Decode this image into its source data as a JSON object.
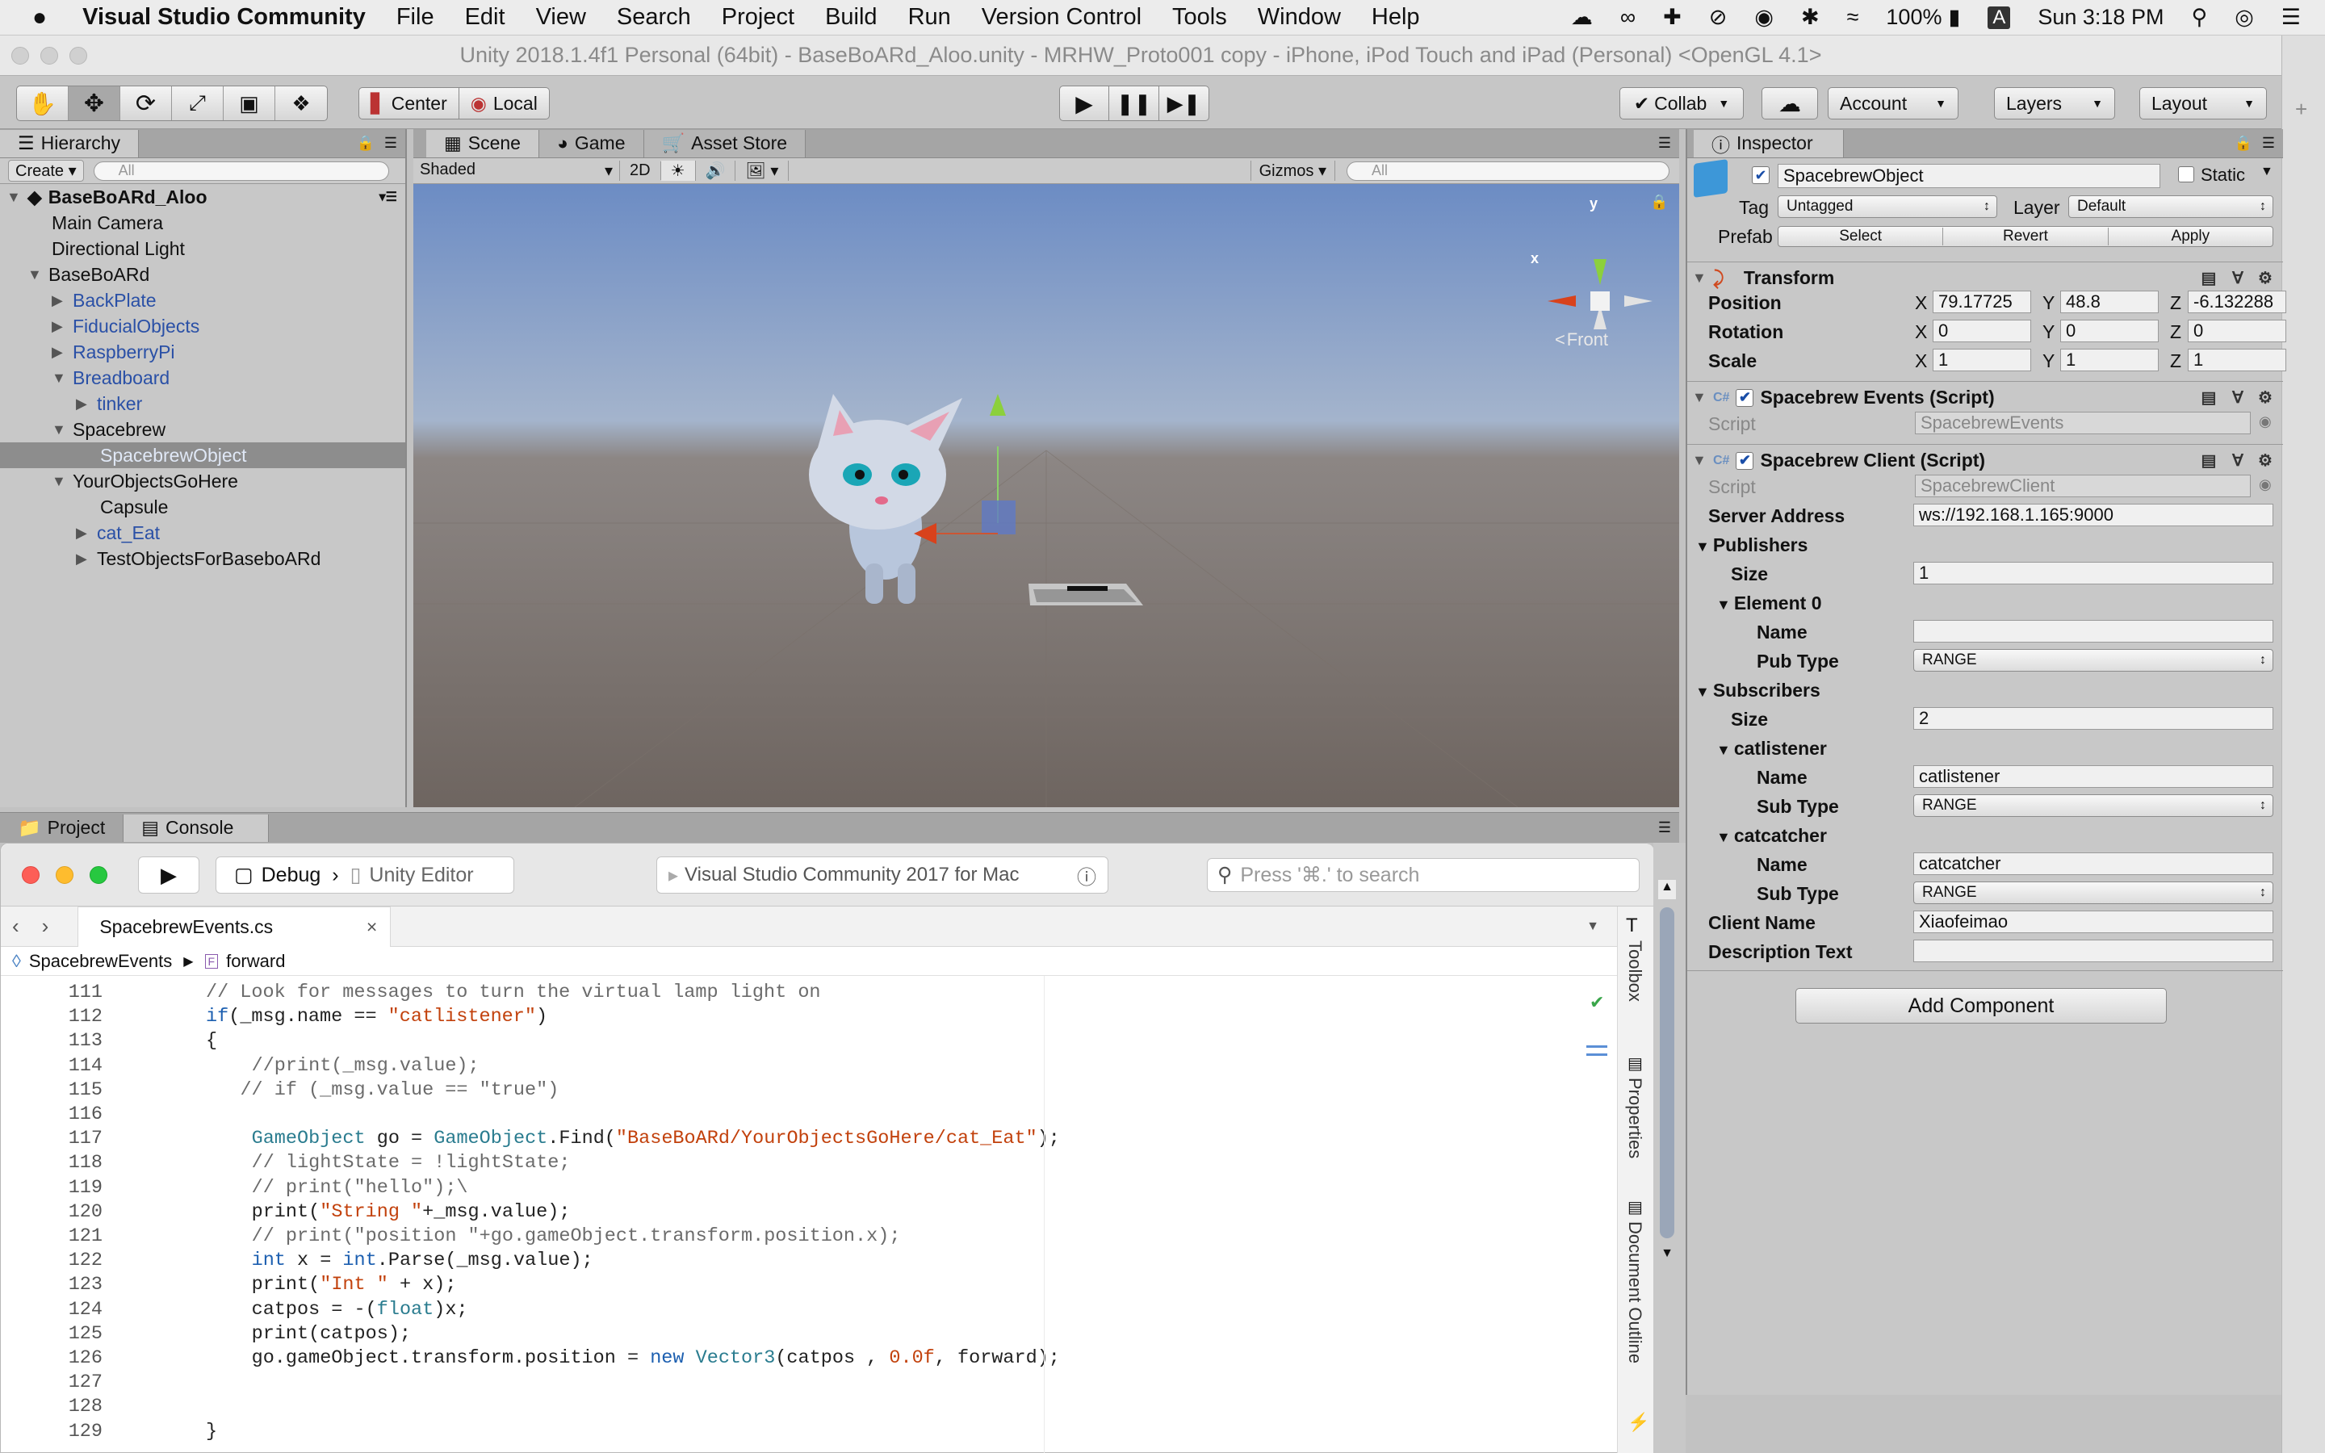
{
  "menubar": {
    "apple": "",
    "app": "Visual Studio Community",
    "items": [
      "File",
      "Edit",
      "View",
      "Search",
      "Project",
      "Build",
      "Run",
      "Version Control",
      "Tools",
      "Window",
      "Help"
    ],
    "battery": "100%",
    "time": "Sun 3:18 PM"
  },
  "unity": {
    "title": "Unity 2018.1.4f1 Personal (64bit) - BaseBoARd_Aloo.unity - MRHW_Proto001 copy - iPhone, iPod Touch and iPad (Personal) <OpenGL 4.1>",
    "toolbar": {
      "center": "Center",
      "local": "Local",
      "collab": "Collab",
      "account": "Account",
      "layers": "Layers",
      "layout": "Layout"
    },
    "hierarchy": {
      "tab": "Hierarchy",
      "create": "Create",
      "search": "All",
      "scene": "BaseBoARd_Aloo",
      "items": [
        {
          "label": "Main Camera",
          "indent": 0,
          "arrow": "",
          "color": "black"
        },
        {
          "label": "Directional Light",
          "indent": 0,
          "arrow": "",
          "color": "black"
        },
        {
          "label": "BaseBoARd",
          "indent": 0,
          "arrow": "down",
          "color": "black"
        },
        {
          "label": "BackPlate",
          "indent": 1,
          "arrow": "right",
          "color": "blue"
        },
        {
          "label": "FiducialObjects",
          "indent": 1,
          "arrow": "right",
          "color": "blue"
        },
        {
          "label": "RaspberryPi",
          "indent": 1,
          "arrow": "right",
          "color": "blue"
        },
        {
          "label": "Breadboard",
          "indent": 1,
          "arrow": "down",
          "color": "blue"
        },
        {
          "label": "tinker",
          "indent": 2,
          "arrow": "right",
          "color": "blue"
        },
        {
          "label": "Spacebrew",
          "indent": 1,
          "arrow": "down",
          "color": "black"
        },
        {
          "label": "SpacebrewObject",
          "indent": 2,
          "arrow": "",
          "color": "selected"
        },
        {
          "label": "YourObjectsGoHere",
          "indent": 1,
          "arrow": "down",
          "color": "black"
        },
        {
          "label": "Capsule",
          "indent": 2,
          "arrow": "",
          "color": "black"
        },
        {
          "label": "cat_Eat",
          "indent": 2,
          "arrow": "right",
          "color": "blue"
        },
        {
          "label": "TestObjectsForBaseboARd",
          "indent": 2,
          "arrow": "right",
          "color": "black"
        }
      ]
    },
    "scene": {
      "tabs": [
        "Scene",
        "Game",
        "Asset Store"
      ],
      "shading": "Shaded",
      "mode2d": "2D",
      "gizmos": "Gizmos",
      "search": "All",
      "axis_y": "y",
      "axis_x": "x",
      "view": "Front"
    },
    "inspector": {
      "tab": "Inspector",
      "object": "SpacebrewObject",
      "static": "Static",
      "tag_label": "Tag",
      "tag": "Untagged",
      "layer_label": "Layer",
      "layer": "Default",
      "prefab": "Prefab",
      "select": "Select",
      "revert": "Revert",
      "apply": "Apply",
      "transform": {
        "title": "Transform",
        "position": "Position",
        "rotation": "Rotation",
        "scale": "Scale",
        "pos": [
          "79.17725",
          "48.8",
          "-6.132288"
        ],
        "rot": [
          "0",
          "0",
          "0"
        ],
        "scl": [
          "1",
          "1",
          "1"
        ]
      },
      "events": {
        "title": "Spacebrew Events (Script)",
        "script_label": "Script",
        "script": "SpacebrewEvents"
      },
      "client": {
        "title": "Spacebrew Client (Script)",
        "script_label": "Script",
        "script": "SpacebrewClient",
        "server_label": "Server Address",
        "server": "ws://192.168.1.165:9000",
        "publishers": "Publishers",
        "size_label": "Size",
        "pub_size": "1",
        "element0": "Element 0",
        "name_label": "Name",
        "pub_name": "",
        "pubtype_label": "Pub Type",
        "pub_type": "RANGE",
        "subscribers": "Subscribers",
        "sub_size": "2",
        "sub1": "catlistener",
        "sub1_name": "catlistener",
        "subtype_label": "Sub Type",
        "sub1_type": "RANGE",
        "sub2": "catcatcher",
        "sub2_name": "catcatcher",
        "sub2_type": "RANGE",
        "client_label": "Client Name",
        "client": "Xiaofeimao",
        "desc_label": "Description Text",
        "desc": ""
      },
      "add_component": "Add Component"
    },
    "bottom_tabs": [
      "Project",
      "Console"
    ]
  },
  "vs": {
    "config": "Debug",
    "target": "Unity Editor",
    "status": "Visual Studio Community 2017 for Mac",
    "search_placeholder": "Press '⌘.' to search",
    "tab": "SpacebrewEvents.cs",
    "crumb1": "SpacebrewEvents",
    "crumb2": "forward",
    "side": [
      "Toolbox",
      "Properties",
      "Document Outline"
    ],
    "lines": [
      {
        "n": "111",
        "ind": 0,
        "t": [
          [
            "cm",
            "// Look for messages to turn the virtual lamp light on"
          ]
        ]
      },
      {
        "n": "112",
        "ind": 0,
        "t": [
          [
            "kw",
            "if"
          ],
          [
            "",
            "(_msg.name == "
          ],
          [
            "st",
            "\"catlistener\""
          ],
          [
            "",
            ")"
          ]
        ]
      },
      {
        "n": "113",
        "ind": 0,
        "t": [
          [
            "",
            "{"
          ]
        ]
      },
      {
        "n": "114",
        "ind": 4,
        "t": [
          [
            "cm",
            "//print(_msg.value);"
          ]
        ]
      },
      {
        "n": "115",
        "ind": 3,
        "t": [
          [
            "cm",
            "// if (_msg.value == \"true\")"
          ]
        ]
      },
      {
        "n": "116",
        "ind": 0,
        "t": []
      },
      {
        "n": "117",
        "ind": 4,
        "t": [
          [
            "ty",
            "GameObject"
          ],
          [
            "",
            " go = "
          ],
          [
            "ty",
            "GameObject"
          ],
          [
            "",
            ".Find("
          ],
          [
            "st",
            "\"BaseBoARd/YourObjectsGoHere/cat_Eat\""
          ],
          [
            "",
            ");"
          ]
        ]
      },
      {
        "n": "118",
        "ind": 4,
        "t": [
          [
            "cm",
            "// lightState = !lightState;"
          ]
        ]
      },
      {
        "n": "119",
        "ind": 4,
        "t": [
          [
            "cm",
            "// print(\"hello\");\\"
          ]
        ]
      },
      {
        "n": "120",
        "ind": 4,
        "t": [
          [
            "",
            "print("
          ],
          [
            "st",
            "\"String \""
          ],
          [
            "",
            "+_msg.value);"
          ]
        ]
      },
      {
        "n": "121",
        "ind": 4,
        "t": [
          [
            "cm",
            "// print(\"position \"+go.gameObject.transform.position.x);"
          ]
        ]
      },
      {
        "n": "122",
        "ind": 4,
        "t": [
          [
            "kw",
            "int"
          ],
          [
            "",
            " x = "
          ],
          [
            "kw",
            "int"
          ],
          [
            "",
            ".Parse(_msg.value);"
          ]
        ]
      },
      {
        "n": "123",
        "ind": 4,
        "t": [
          [
            "",
            "print("
          ],
          [
            "st",
            "\"Int \""
          ],
          [
            "",
            " + x);"
          ]
        ]
      },
      {
        "n": "124",
        "ind": 4,
        "t": [
          [
            "",
            "catpos = -("
          ],
          [
            "ty",
            "float"
          ],
          [
            "",
            ")x;"
          ]
        ]
      },
      {
        "n": "125",
        "ind": 4,
        "t": [
          [
            "",
            "print(catpos);"
          ]
        ]
      },
      {
        "n": "126",
        "ind": 4,
        "t": [
          [
            "",
            "go.gameObject.transform.position = "
          ],
          [
            "kw",
            "new"
          ],
          [
            " ",
            ""
          ],
          [
            "ty",
            "Vector3"
          ],
          [
            "",
            "(catpos , "
          ],
          [
            "nm",
            "0.0f"
          ],
          [
            "",
            ", forward);"
          ]
        ]
      },
      {
        "n": "127",
        "ind": 0,
        "t": []
      },
      {
        "n": "128",
        "ind": 0,
        "t": []
      },
      {
        "n": "129",
        "ind": 0,
        "t": [
          [
            "",
            "}"
          ]
        ]
      }
    ]
  }
}
